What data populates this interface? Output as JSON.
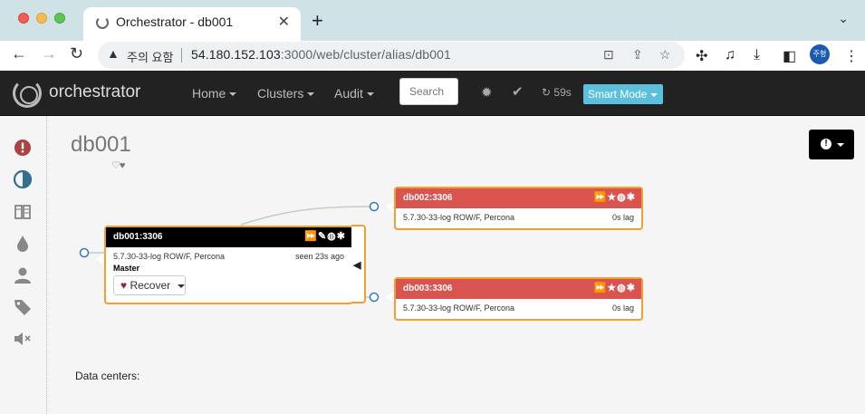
{
  "browser": {
    "tab_title": "Orchestrator - db001",
    "tab_close": "✕",
    "new_tab": "+",
    "security_label": "주의 요함",
    "url_host": "54.180.152.103",
    "url_path": ":3000/web/cluster/alias/db001",
    "profile": "주형"
  },
  "navbar": {
    "brand": "orchestrator",
    "menu": [
      {
        "label": "Home"
      },
      {
        "label": "Clusters"
      },
      {
        "label": "Audit"
      }
    ],
    "search_placeholder": "Search",
    "refresh_label": "59s",
    "smart_mode_label": "Smart Mode"
  },
  "page": {
    "title": "db001",
    "hearts": "♡♥",
    "data_centers_label": "Data centers:"
  },
  "instances": {
    "master": {
      "name": "db001:3306",
      "version": "5.7.30-33-log ROW/F, Percona",
      "seen": "seen 23s ago",
      "role": "Master",
      "icons": "⏩✎◍✱",
      "recover_label": "Recover"
    },
    "replica1": {
      "name": "db002:3306",
      "version": "5.7.30-33-log ROW/F, Percona",
      "lag": "0s lag",
      "icons": "⏩★◍✱"
    },
    "replica2": {
      "name": "db003:3306",
      "version": "5.7.30-33-log ROW/F, Percona",
      "lag": "0s lag",
      "icons": "⏩★◍✱"
    }
  },
  "colors": {
    "problem_red": "#d9534f",
    "smart_mode_blue": "#5bc0de",
    "highlight_orange": "#f0a030",
    "sidebar_blue": "#31708f",
    "sidebar_red": "#a94442"
  }
}
